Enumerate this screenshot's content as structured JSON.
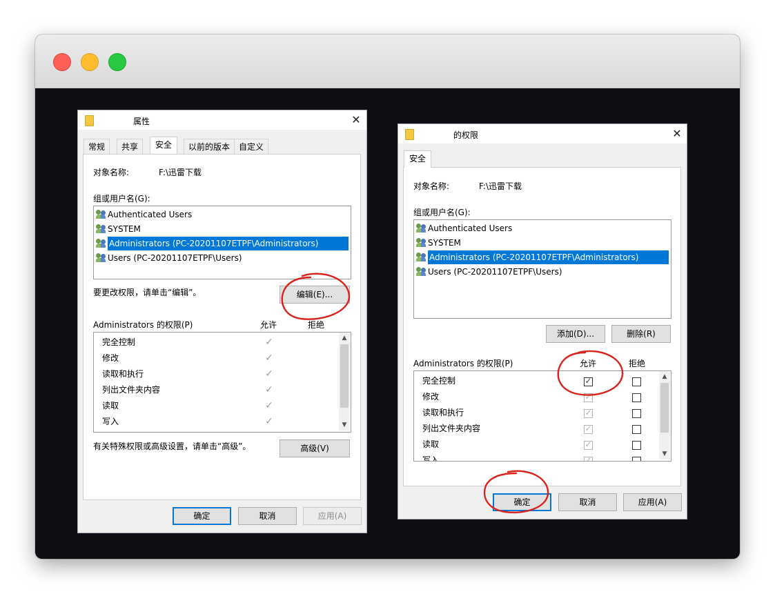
{
  "left_dialog": {
    "title": "属性",
    "tabs": [
      "常规",
      "共享",
      "安全",
      "以前的版本",
      "自定义"
    ],
    "active_tab": "安全",
    "object_label": "对象名称:",
    "object_value": "F:\\迅雷下载",
    "group_label": "组或用户名(G):",
    "users": [
      "Authenticated Users",
      "SYSTEM",
      "Administrators (PC-20201107ETPF\\Administrators)",
      "Users (PC-20201107ETPF\\Users)"
    ],
    "selected_user_index": 2,
    "edit_hint": "要更改权限，请单击“编辑”。",
    "edit_button": "编辑(E)...",
    "perm_label": "Administrators 的权限(P)",
    "allow_header": "允许",
    "deny_header": "拒绝",
    "permissions": [
      "完全控制",
      "修改",
      "读取和执行",
      "列出文件夹内容",
      "读取",
      "写入"
    ],
    "advanced_hint": "有关特殊权限或高级设置，请单击“高级”。",
    "advanced_button": "高级(V)",
    "ok_button": "确定",
    "cancel_button": "取消",
    "apply_button": "应用(A)"
  },
  "right_dialog": {
    "title": "的权限",
    "tab": "安全",
    "object_label": "对象名称:",
    "object_value": "F:\\迅雷下载",
    "group_label": "组或用户名(G):",
    "users": [
      "Authenticated Users",
      "SYSTEM",
      "Administrators (PC-20201107ETPF\\Administrators)",
      "Users (PC-20201107ETPF\\Users)"
    ],
    "selected_user_index": 2,
    "add_button": "添加(D)...",
    "remove_button": "删除(R)",
    "perm_label": "Administrators 的权限(P)",
    "allow_header": "允许",
    "deny_header": "拒绝",
    "permissions": [
      "完全控制",
      "修改",
      "读取和执行",
      "列出文件夹内容",
      "读取",
      "写入"
    ],
    "ok_button": "确定",
    "cancel_button": "取消",
    "apply_button": "应用(A)"
  },
  "colors": {
    "selection": "#0078d7",
    "annotation": "#d8231f",
    "dark_background": "#0e0e14"
  }
}
